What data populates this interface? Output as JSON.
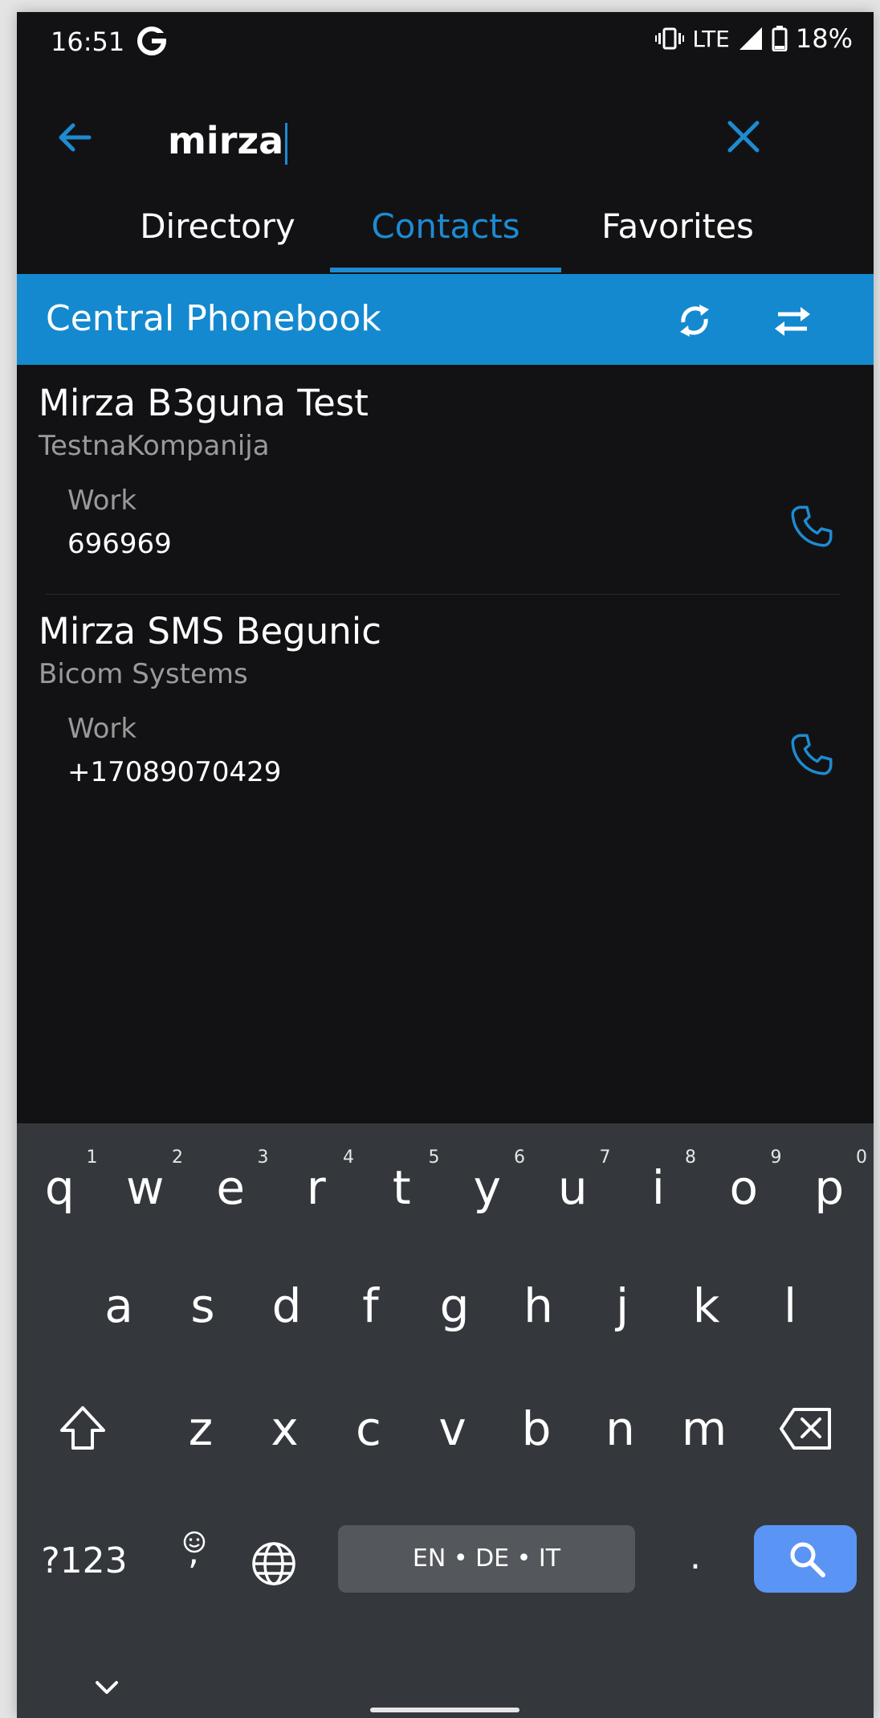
{
  "status_bar": {
    "time": "16:51",
    "network": "LTE",
    "battery": "18%"
  },
  "search": {
    "query": "mirza"
  },
  "tabs": [
    {
      "label": "Directory",
      "active": false
    },
    {
      "label": "Contacts",
      "active": true
    },
    {
      "label": "Favorites",
      "active": false
    }
  ],
  "header": {
    "title": "Central Phonebook"
  },
  "contacts": [
    {
      "name": "Mirza B3guna Test",
      "company": "TestnaKompanija",
      "phone_label": "Work",
      "phone": "696969"
    },
    {
      "name": "Mirza SMS Begunic",
      "company": "Bicom Systems",
      "phone_label": "Work",
      "phone": "+17089070429"
    }
  ],
  "keyboard": {
    "row1": [
      {
        "k": "q",
        "n": "1"
      },
      {
        "k": "w",
        "n": "2"
      },
      {
        "k": "e",
        "n": "3"
      },
      {
        "k": "r",
        "n": "4"
      },
      {
        "k": "t",
        "n": "5"
      },
      {
        "k": "y",
        "n": "6"
      },
      {
        "k": "u",
        "n": "7"
      },
      {
        "k": "i",
        "n": "8"
      },
      {
        "k": "o",
        "n": "9"
      },
      {
        "k": "p",
        "n": "0"
      }
    ],
    "row2": [
      "a",
      "s",
      "d",
      "f",
      "g",
      "h",
      "j",
      "k",
      "l"
    ],
    "row3": [
      "z",
      "x",
      "c",
      "v",
      "b",
      "n",
      "m"
    ],
    "symbols_label": "?123",
    "comma_label": ",",
    "space_label": "EN • DE • IT",
    "period_label": "."
  },
  "colors": {
    "accent": "#1e8bd1",
    "header_bg": "#1489cf",
    "background": "#121214",
    "keyboard_bg": "#34383d",
    "search_key": "#5a95f5"
  }
}
